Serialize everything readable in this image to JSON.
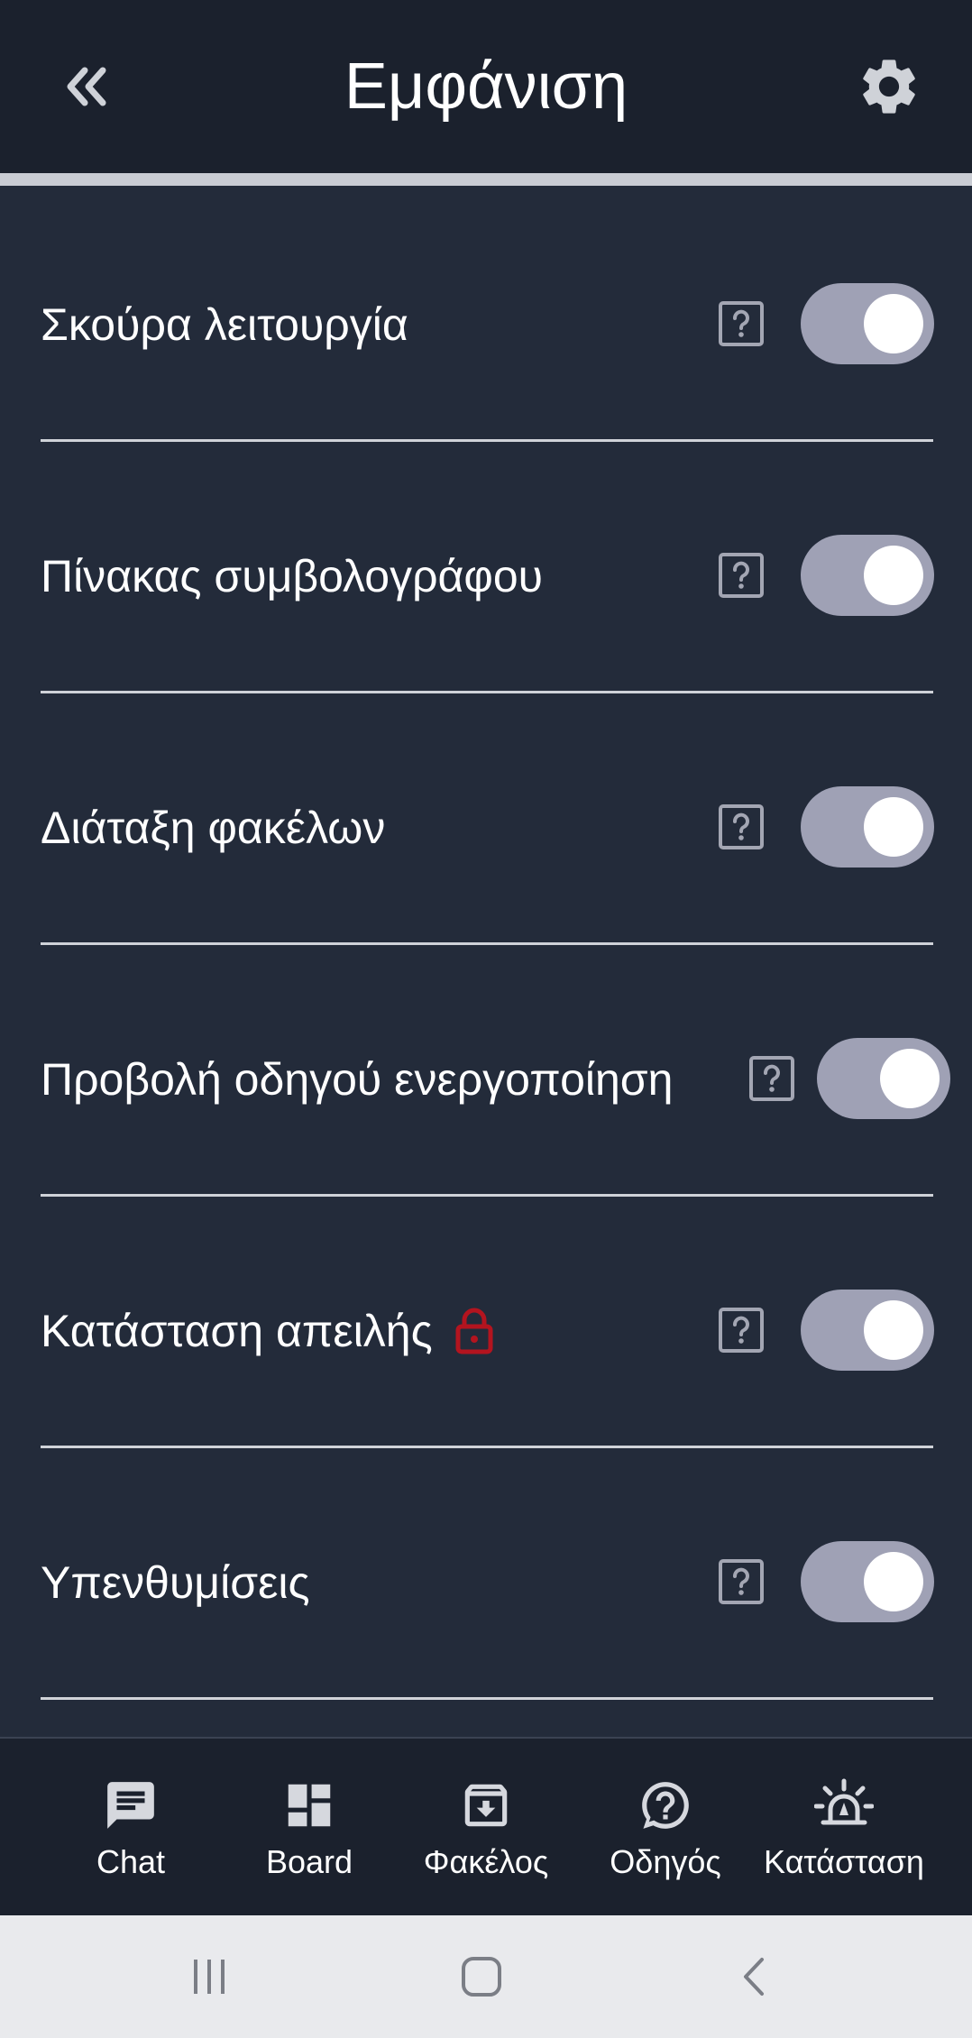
{
  "header": {
    "title": "Εμφάνιση",
    "back_icon": "double-chevron-left-icon",
    "settings_icon": "gear-icon"
  },
  "settings": [
    {
      "label": "Σκούρα λειτουργία",
      "enabled": true
    },
    {
      "label": "Πίνακας συμβολογράφου",
      "enabled": true
    },
    {
      "label": "Διάταξη φακέλων",
      "enabled": true
    },
    {
      "label": "Προβολή οδηγού ενεργοποίηση",
      "enabled": true
    },
    {
      "label": "Κατάσταση απειλής",
      "enabled": true,
      "locked": true
    },
    {
      "label": "Υπενθυμίσεις",
      "enabled": true
    }
  ],
  "bottom_nav": [
    {
      "label": "Chat",
      "icon": "chat-icon"
    },
    {
      "label": "Board",
      "icon": "dashboard-icon"
    },
    {
      "label": "Φακέλος",
      "icon": "archive-icon"
    },
    {
      "label": "Οδηγός",
      "icon": "help-bubble-icon"
    },
    {
      "label": "Κατάσταση",
      "icon": "alarm-light-icon"
    }
  ],
  "colors": {
    "background": "#232b3a",
    "header": "#1b212d",
    "toggle_track": "#9fa1b5",
    "lock": "#b3141f"
  }
}
